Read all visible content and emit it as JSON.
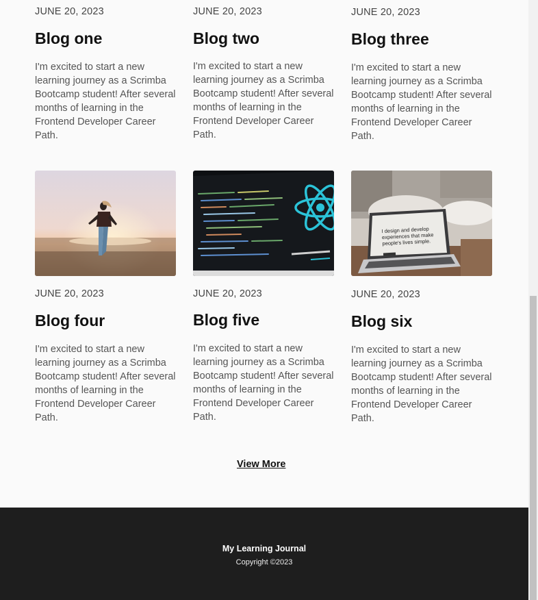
{
  "posts_top": [
    {
      "date": "JUNE 20, 2023",
      "title": "Blog one",
      "excerpt": "I'm excited to start a new learning journey as a Scrimba Bootcamp student! After several months of learning in the Frontend Developer Career Path."
    },
    {
      "date": "JUNE 20, 2023",
      "title": "Blog two",
      "excerpt": "I'm excited to start a new learning journey as a Scrimba Bootcamp student! After several months of learning in the Frontend Developer Career Path."
    },
    {
      "date": "JUNE 20, 2023",
      "title": "Blog three",
      "excerpt": "I'm excited to start a new learning journey as a Scrimba Bootcamp student! After several months of learning in the Frontend Developer Career Path."
    }
  ],
  "posts_bottom": [
    {
      "date": "JUNE 20, 2023",
      "title": "Blog four",
      "excerpt": "I'm excited to start a new learning journey as a Scrimba Bootcamp student! After several months of learning in the Frontend Developer Career Path.",
      "image": "beach-dancer-photo"
    },
    {
      "date": "JUNE 20, 2023",
      "title": "Blog five",
      "excerpt": "I'm excited to start a new learning journey as a Scrimba Bootcamp student! After several months of learning in the Frontend Developer Career Path.",
      "image": "react-code-screen-photo"
    },
    {
      "date": "JUNE 20, 2023",
      "title": "Blog six",
      "excerpt": "I'm excited to start a new learning journey as a Scrimba Bootcamp student! After several months of learning in the Frontend Developer Career Path.",
      "image": "laptop-on-table-photo",
      "image_text": "I design and develop experiences that make people's lives simple."
    }
  ],
  "view_more": "View More",
  "footer": {
    "brand": "My Learning Journal",
    "copyright": "Copyright ©2023"
  },
  "colors": {
    "page_bg": "#fafafa",
    "footer_bg": "#1e1e1e",
    "react_accent": "#2bc3d8"
  }
}
